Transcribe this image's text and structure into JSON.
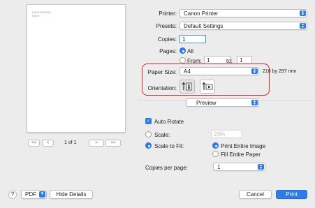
{
  "preview": {
    "page_text_line1": "0000000000",
    "page_text_line2": "0000",
    "nav_first": "<<",
    "nav_prev": "<",
    "page_indicator": "1 of 1",
    "nav_next": ">",
    "nav_last": ">>"
  },
  "printer": {
    "label": "Printer:",
    "value": "Canon Printer"
  },
  "presets": {
    "label": "Presets:",
    "value": "Default Settings"
  },
  "copies": {
    "label": "Copies:",
    "value": "1"
  },
  "pages": {
    "label": "Pages:",
    "all_label": "All",
    "from_label": "From:",
    "from_value": "1",
    "to_label": "to:",
    "to_value": "1"
  },
  "paper_size": {
    "label": "Paper Size:",
    "value": "A4",
    "dimensions": "210 by 297 mm"
  },
  "orientation": {
    "label": "Orientation:"
  },
  "section_select": {
    "value": "Preview"
  },
  "auto_rotate": {
    "label": "Auto Rotate",
    "checked": true
  },
  "scale": {
    "label": "Scale:",
    "placeholder": "23%"
  },
  "scale_to_fit": {
    "label": "Scale to Fit:",
    "print_entire_image": "Print Entire Image",
    "fill_entire_paper": "Fill Entire Paper"
  },
  "copies_per_page": {
    "label": "Copies per page:",
    "value": "1"
  },
  "footer": {
    "help": "?",
    "pdf": "PDF",
    "hide_details": "Hide Details",
    "cancel": "Cancel",
    "print": "Print"
  },
  "colors": {
    "accent": "#2f7ce6",
    "highlight": "#d9232e"
  }
}
